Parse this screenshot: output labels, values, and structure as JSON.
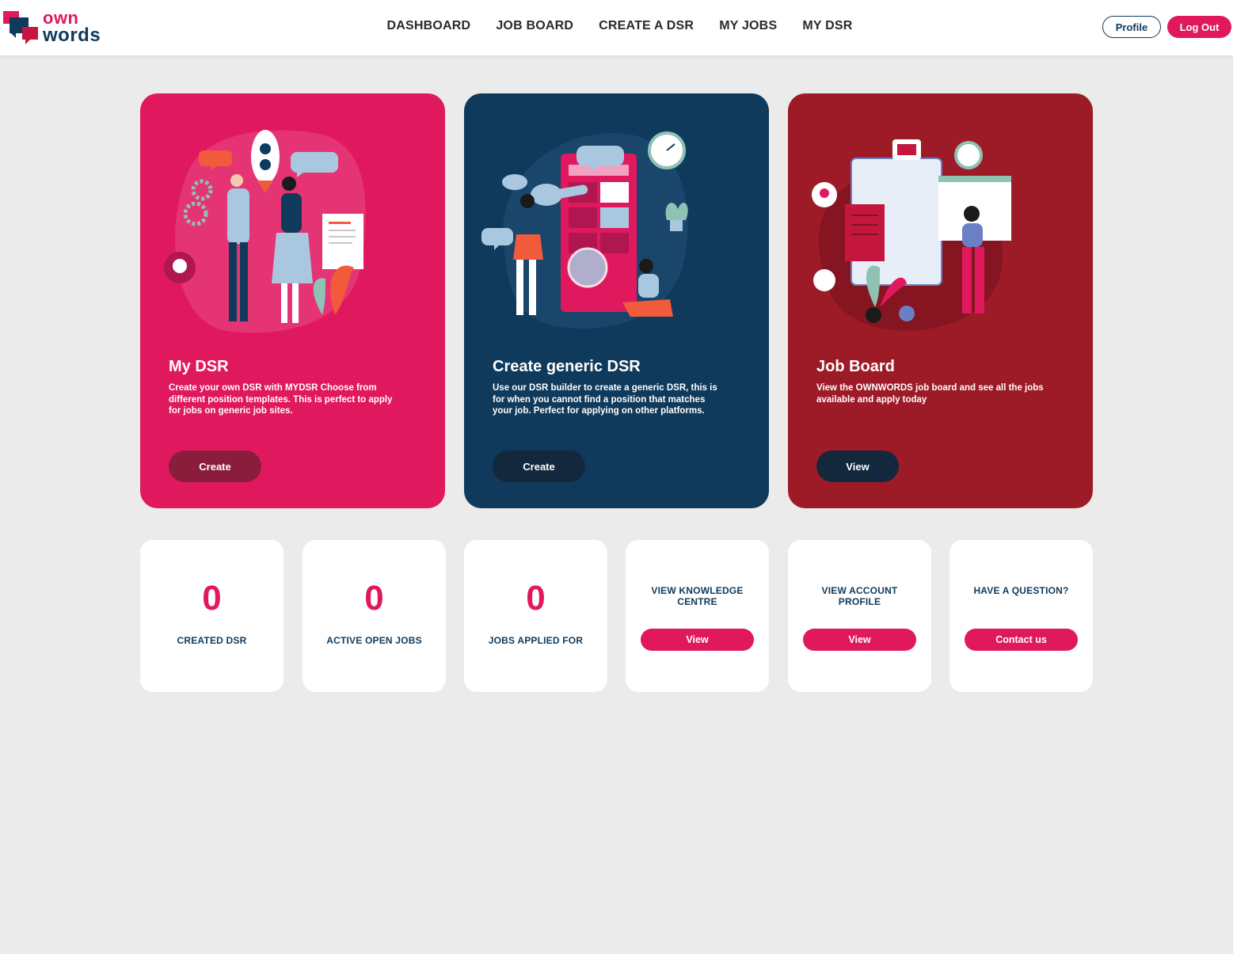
{
  "brand": {
    "line1": "own",
    "line2": "words",
    "primary": "#e0195f",
    "navy": "#0f3a5c"
  },
  "nav": [
    {
      "label": "DASHBOARD"
    },
    {
      "label": "JOB BOARD"
    },
    {
      "label": "CREATE A DSR"
    },
    {
      "label": "MY JOBS"
    },
    {
      "label": "MY DSR"
    }
  ],
  "header": {
    "profile_label": "Profile",
    "logout_label": "Log Out"
  },
  "cards": [
    {
      "title": "My DSR",
      "description": "Create your own DSR with MYDSR Choose from different position templates. This is perfect to apply for jobs on generic job sites.",
      "button": "Create",
      "color": "#e0195f",
      "illustration": "handshake-rocket-illustration"
    },
    {
      "title": "Create generic DSR",
      "description": "Use our DSR builder to create a generic DSR, this is for when you cannot find a position that matches your job. Perfect for applying on other platforms.",
      "button": "Create",
      "color": "#0f3a5c",
      "illustration": "telescope-search-illustration"
    },
    {
      "title": "Job Board",
      "description": "View the OWNWORDS job board and see all the jobs available and apply today",
      "button": "View",
      "color": "#9d1b27",
      "illustration": "clipboard-calendar-illustration"
    }
  ],
  "stats": [
    {
      "value": "0",
      "label": "CREATED DSR"
    },
    {
      "value": "0",
      "label": "ACTIVE OPEN JOBS"
    },
    {
      "value": "0",
      "label": "JOBS APPLIED FOR"
    }
  ],
  "links": [
    {
      "label_line1": "VIEW KNOWLEDGE",
      "label_line2": "CENTRE",
      "button": "View"
    },
    {
      "label_line1": "VIEW ACCOUNT",
      "label_line2": "PROFILE",
      "button": "View"
    },
    {
      "label_line1": "HAVE A QUESTION?",
      "label_line2": "",
      "button": "Contact us"
    }
  ]
}
